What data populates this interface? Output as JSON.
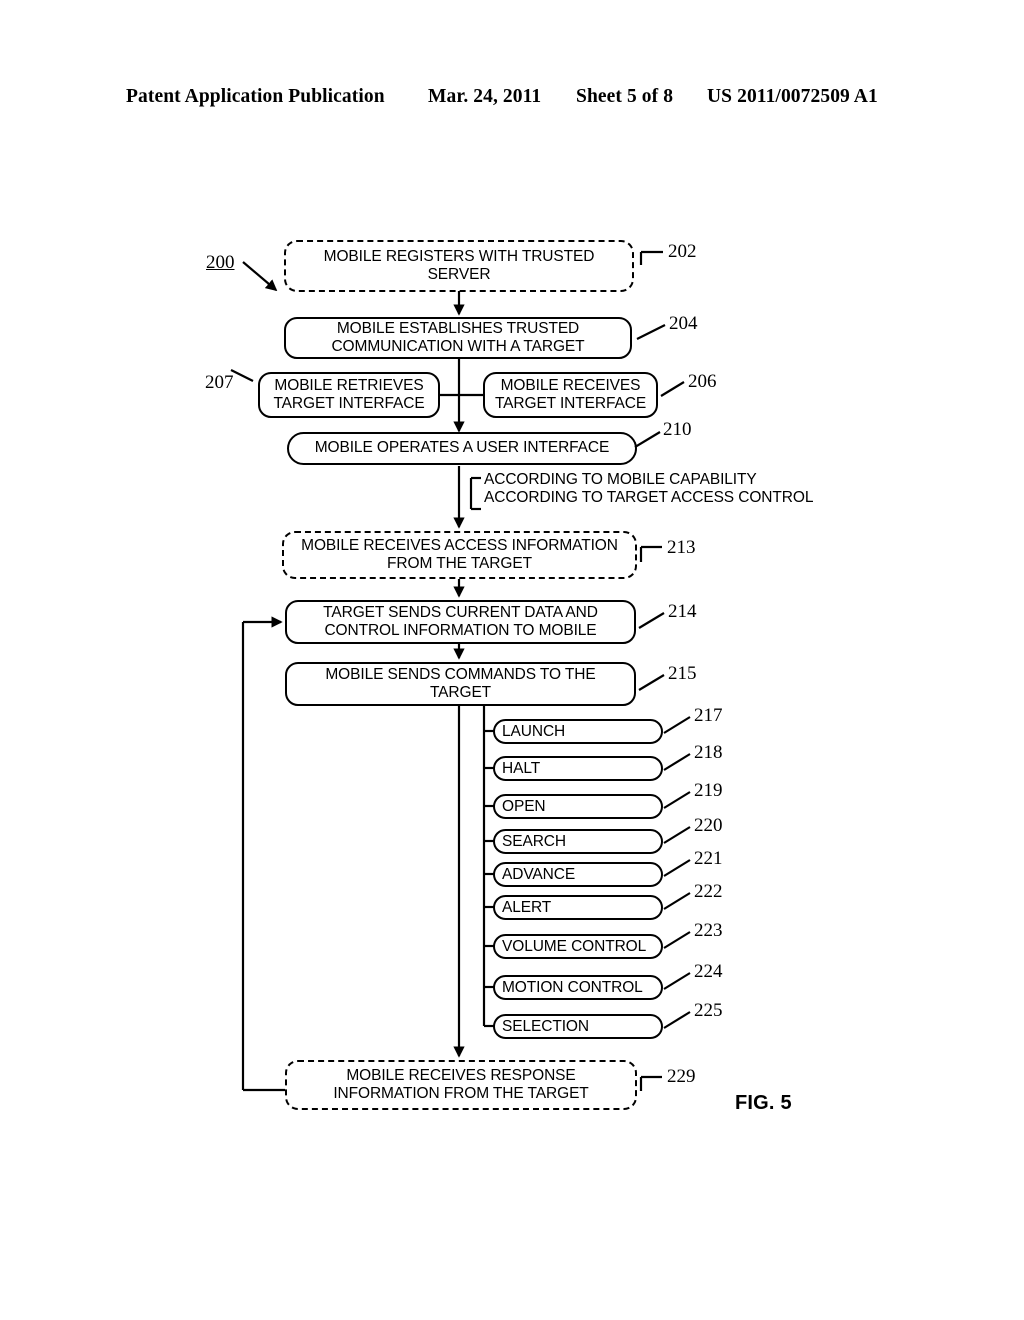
{
  "header": {
    "publication": "Patent Application Publication",
    "date": "Mar. 24, 2011",
    "sheet": "Sheet 5 of 8",
    "patent_number": "US 2011/0072509 A1"
  },
  "figure": {
    "caption": "FIG. 5",
    "diagram_label": "200",
    "nodes": [
      {
        "ref": "202",
        "text": "MOBILE REGISTERS WITH TRUSTED SERVER",
        "style": "dashed"
      },
      {
        "ref": "204",
        "text": "MOBILE ESTABLISHES TRUSTED COMMUNICATION WITH A TARGET",
        "style": "solid"
      },
      {
        "ref": "207",
        "text": "MOBILE RETRIEVES TARGET INTERFACE",
        "style": "solid"
      },
      {
        "ref": "206",
        "text": "MOBILE RECEIVES TARGET INTERFACE",
        "style": "solid"
      },
      {
        "ref": "210",
        "text": "MOBILE OPERATES A USER INTERFACE",
        "style": "solid"
      },
      {
        "ref": "213",
        "text": "MOBILE RECEIVES ACCESS INFORMATION FROM THE TARGET",
        "style": "dashed"
      },
      {
        "ref": "214",
        "text": "TARGET SENDS CURRENT DATA AND CONTROL INFORMATION TO MOBILE",
        "style": "solid"
      },
      {
        "ref": "215",
        "text": "MOBILE SENDS COMMANDS TO THE TARGET",
        "style": "solid"
      },
      {
        "ref": "229",
        "text": "MOBILE RECEIVES RESPONSE INFORMATION FROM THE TARGET",
        "style": "dashed"
      }
    ],
    "annotations": [
      "ACCORDING TO MOBILE CAPABILITY",
      "ACCORDING TO TARGET ACCESS CONTROL"
    ],
    "commands": [
      {
        "ref": "217",
        "label": "LAUNCH"
      },
      {
        "ref": "218",
        "label": "HALT"
      },
      {
        "ref": "219",
        "label": "OPEN"
      },
      {
        "ref": "220",
        "label": "SEARCH"
      },
      {
        "ref": "221",
        "label": "ADVANCE"
      },
      {
        "ref": "222",
        "label": "ALERT"
      },
      {
        "ref": "223",
        "label": "VOLUME CONTROL"
      },
      {
        "ref": "224",
        "label": "MOTION CONTROL"
      },
      {
        "ref": "225",
        "label": "SELECTION"
      }
    ]
  }
}
